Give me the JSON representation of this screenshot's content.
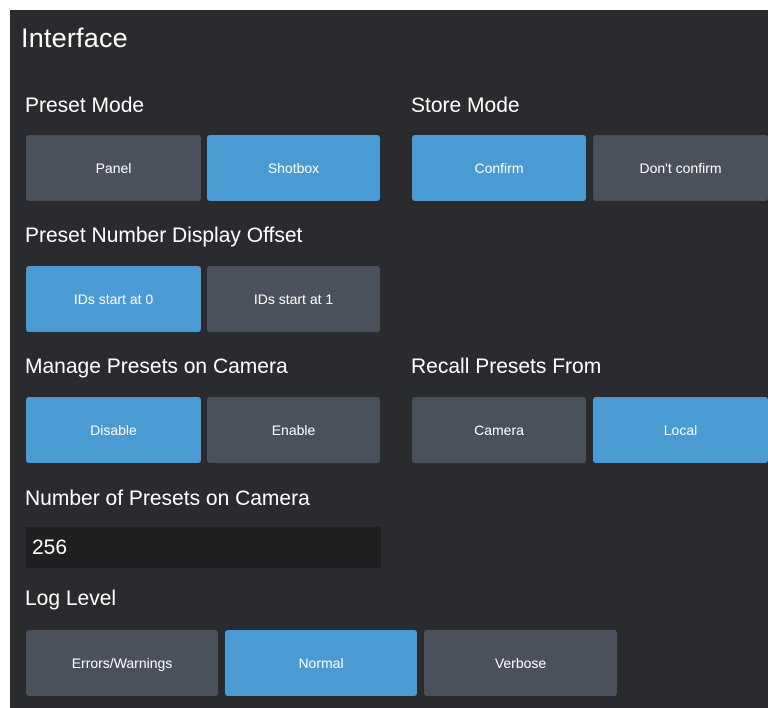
{
  "title": "Interface",
  "preset_mode": {
    "label": "Preset Mode",
    "options": [
      "Panel",
      "Shotbox"
    ],
    "selected": "Shotbox"
  },
  "store_mode": {
    "label": "Store Mode",
    "options": [
      "Confirm",
      "Don't confirm"
    ],
    "selected": "Confirm"
  },
  "preset_offset": {
    "label": "Preset Number Display Offset",
    "options": [
      "IDs start at 0",
      "IDs start at 1"
    ],
    "selected": "IDs start at 0"
  },
  "manage_presets": {
    "label": "Manage Presets on Camera",
    "options": [
      "Disable",
      "Enable"
    ],
    "selected": "Disable"
  },
  "recall_presets": {
    "label": "Recall Presets From",
    "options": [
      "Camera",
      "Local"
    ],
    "selected": "Local"
  },
  "num_presets": {
    "label": "Number of Presets on Camera",
    "value": "256"
  },
  "log_level": {
    "label": "Log Level",
    "options": [
      "Errors/Warnings",
      "Normal",
      "Verbose"
    ],
    "selected": "Normal"
  },
  "colors": {
    "background": "#2a2b2e",
    "button_off": "#4a505c",
    "button_on": "#4a9ad4",
    "input_bg": "#1f1f21",
    "text": "#ffffff"
  }
}
